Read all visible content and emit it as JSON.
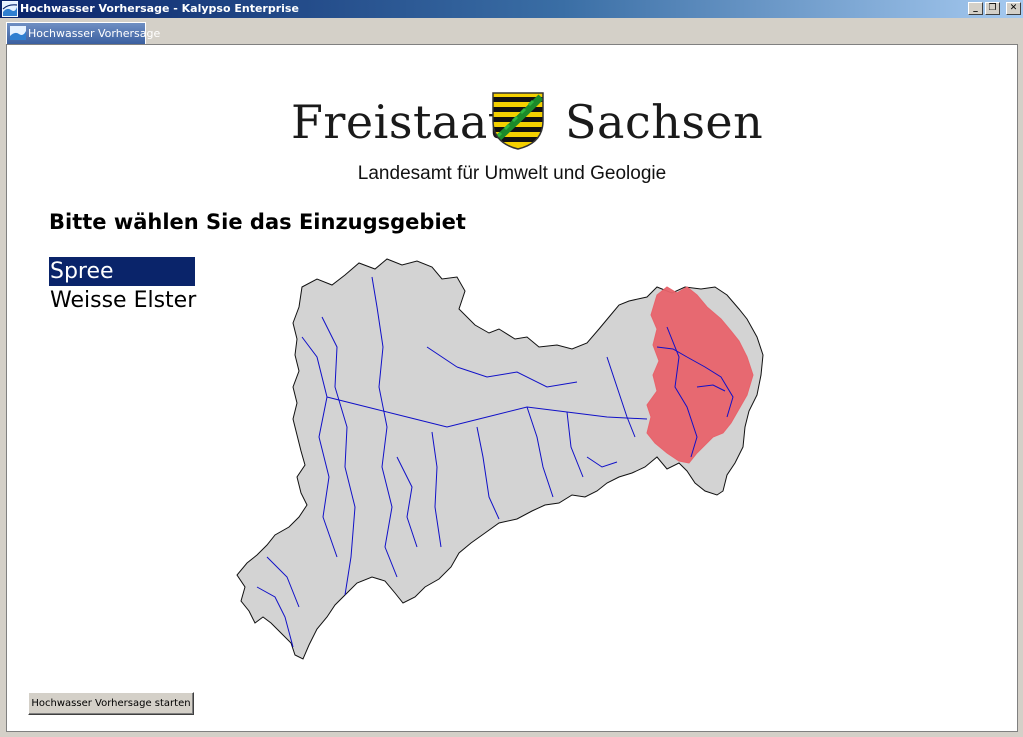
{
  "window": {
    "title": "Hochwasser Vorhersage - Kalypso Enterprise",
    "controls": {
      "minimize": "_",
      "restore": "❐",
      "close": "✕"
    }
  },
  "tabs": [
    {
      "label": "Hochwasser Vorhersage",
      "icon": "kalypso-icon",
      "active": true
    }
  ],
  "header": {
    "logo_left": "Freistaat",
    "logo_right": "Sachsen",
    "crest_icon": "saxony-crest-icon",
    "subtitle": "Landesamt für Umwelt und Geologie"
  },
  "main": {
    "heading": "Bitte wählen Sie das Einzugsgebiet",
    "catchments": [
      {
        "label": "Spree",
        "selected": true
      },
      {
        "label": "Weisse Elster",
        "selected": false
      }
    ],
    "map": {
      "region_fill": "#d3d3d3",
      "highlight_fill": "#e8636b",
      "river_color": "#1010c8"
    }
  },
  "footer": {
    "start_button": "Hochwasser Vorhersage starten"
  },
  "colors": {
    "titlebar_start": "#0a246a",
    "titlebar_end": "#a6caf0",
    "selection": "#0a246a"
  }
}
